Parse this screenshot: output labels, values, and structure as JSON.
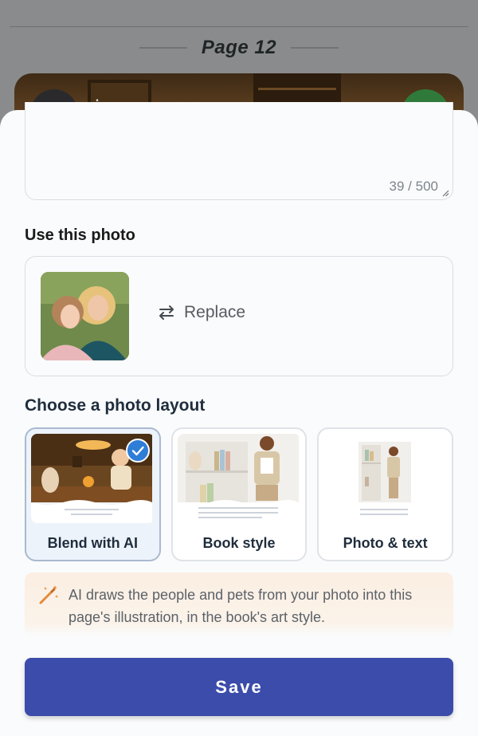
{
  "background_page": {
    "title": "Page 12"
  },
  "sheet": {
    "text_entry": {
      "char_count": "39 / 500"
    },
    "photo_section": {
      "heading": "Use this photo",
      "replace_label": "Replace"
    },
    "layout_section": {
      "heading": "Choose a photo layout",
      "options": [
        {
          "label": "Blend with AI",
          "selected": true
        },
        {
          "label": "Book style",
          "selected": false
        },
        {
          "label": "Photo & text",
          "selected": false
        }
      ]
    },
    "info_text": "AI draws the people and pets from your photo into this page's illustration, in the book's art style.",
    "save_label": "Save"
  },
  "colors": {
    "primary": "#3b4caa",
    "selected_check": "#2e7dd7",
    "info_bg": "#fbeee2",
    "info_icon": "#e58a3c"
  },
  "icons": [
    "zoom-icon",
    "more-icon",
    "confirm-icon",
    "replace-icon",
    "check-icon",
    "magic-wand-icon",
    "resize-grip-icon"
  ]
}
